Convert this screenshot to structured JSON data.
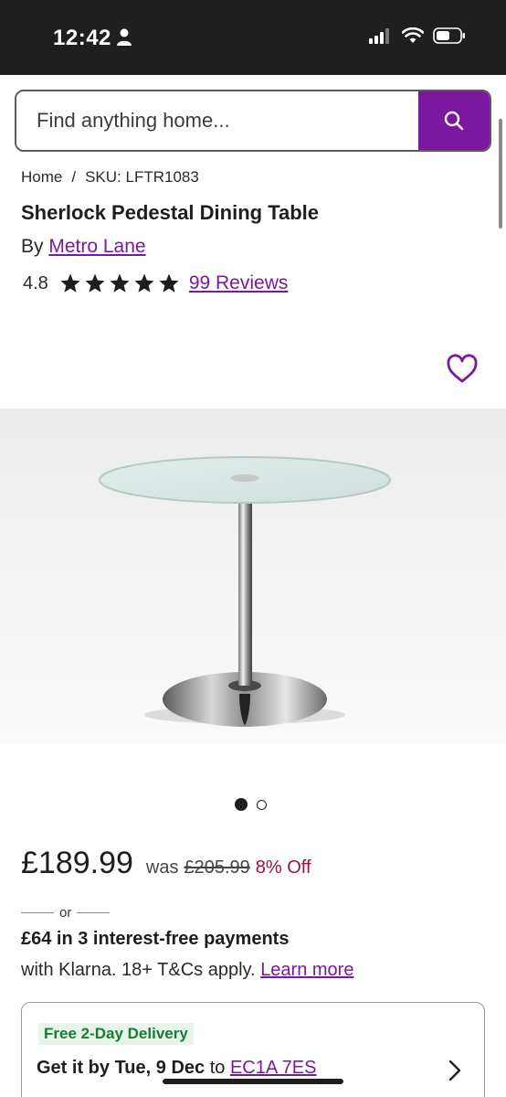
{
  "status_bar": {
    "time": "12:42"
  },
  "search": {
    "placeholder": "Find anything home..."
  },
  "breadcrumb": {
    "home": "Home",
    "separator": "/",
    "sku": "SKU: LFTR1083"
  },
  "product": {
    "title": "Sherlock Pedestal Dining Table",
    "by_prefix": "By",
    "brand": "Metro Lane",
    "rating": "4.8",
    "stars": 5,
    "reviews_label": "99 Reviews"
  },
  "carousel": {
    "total": 2,
    "active": 1
  },
  "pricing": {
    "price": "£189.99",
    "was_label": "was",
    "was_price": "£205.99",
    "discount": "8% Off"
  },
  "klarna": {
    "or_label": "or",
    "payments": "£64 in 3 interest-free payments",
    "details": "with Klarna. 18+ T&Cs apply.",
    "learn_more": "Learn more"
  },
  "delivery": {
    "badge": "Free 2-Day Delivery",
    "prefix": "Get it by",
    "date": "Tue, 9 Dec",
    "to_label": "to",
    "postcode": "EC1A 7ES"
  },
  "colors": {
    "accent": "#7b189f",
    "discount": "#a0103d",
    "badge_bg": "#e7f4e9",
    "badge_text": "#1b7a33"
  }
}
